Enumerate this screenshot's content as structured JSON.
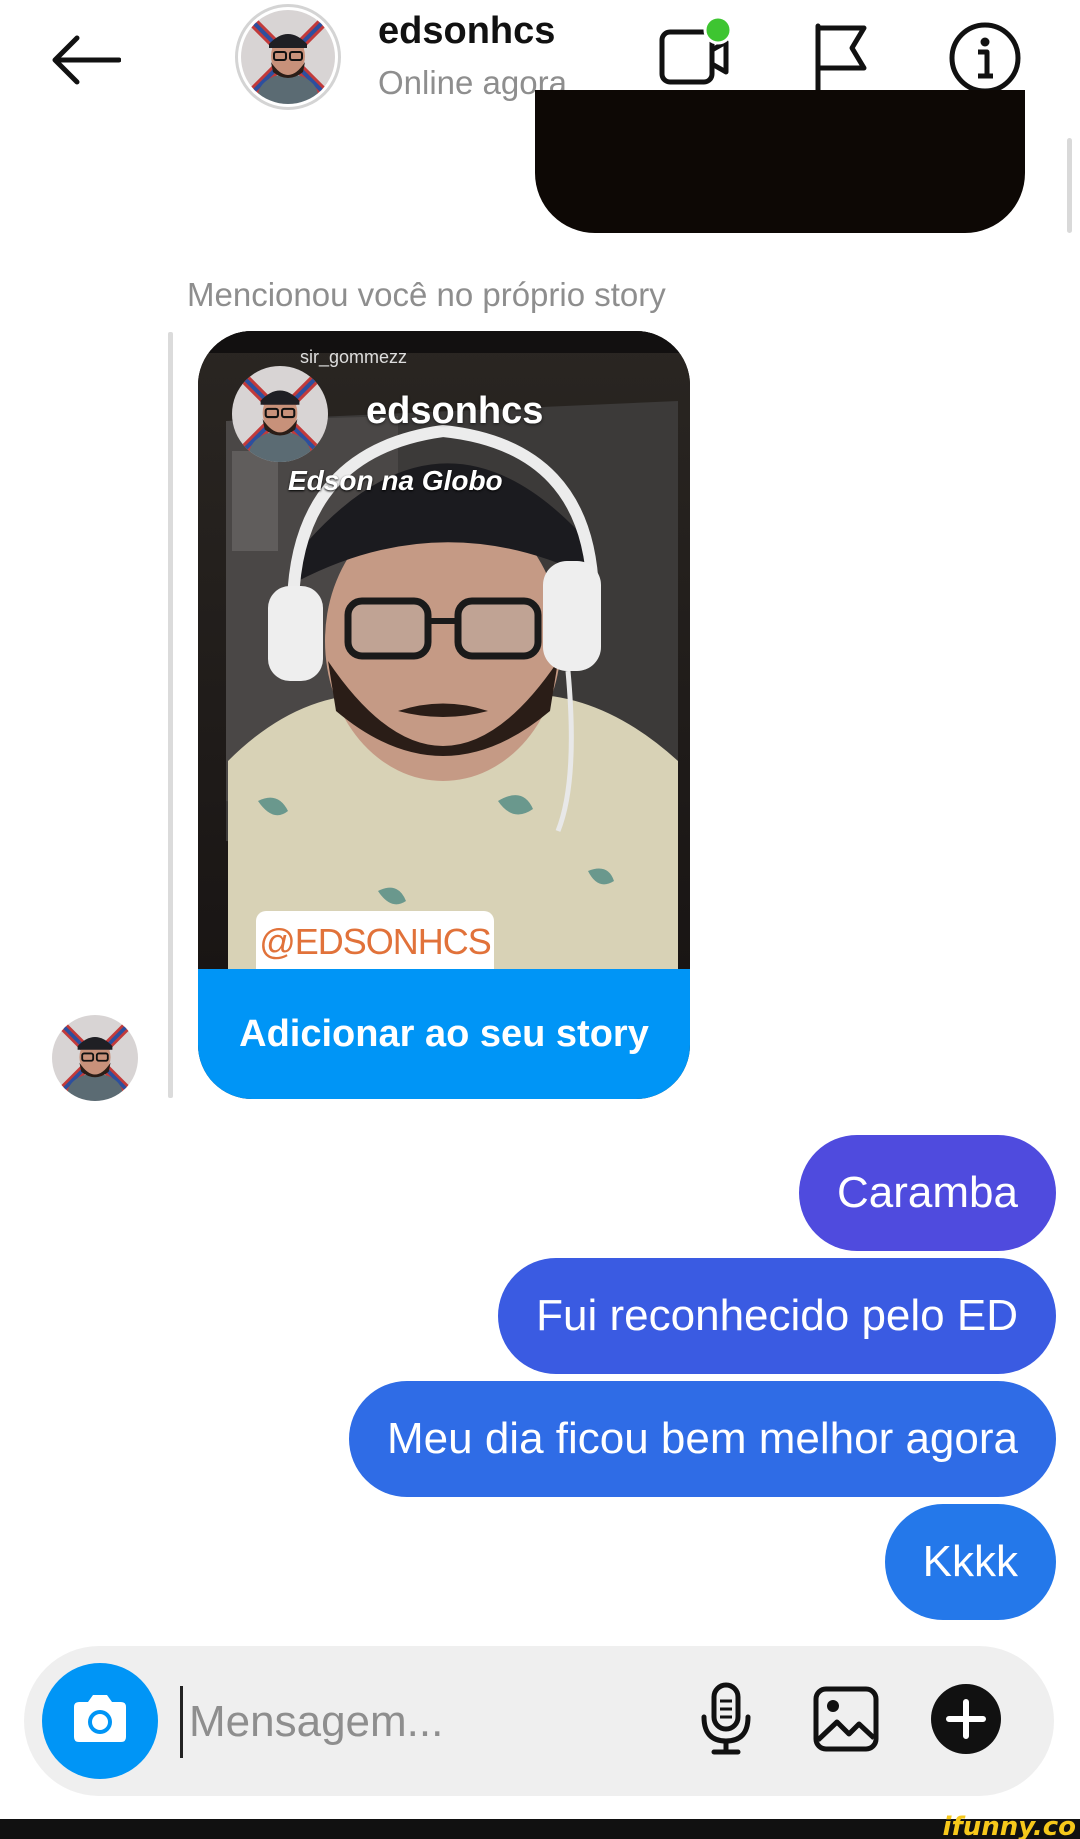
{
  "header": {
    "username": "edsonhcs",
    "status": "Online agora",
    "icons": [
      "back-arrow-icon",
      "video-call-icon",
      "flag-icon",
      "info-icon"
    ],
    "online_dot_color": "#3ec531"
  },
  "mention": {
    "caption": "Mencionou você no próprio story"
  },
  "story": {
    "sub_username": "sir_gommezz",
    "username": "edsonhcs",
    "caption": "Edson na Globo",
    "mention_tag": "@EDSONHCS",
    "add_button_label": "Adicionar ao seu story"
  },
  "messages": [
    {
      "text": "Caramba",
      "color": "#4f4bde"
    },
    {
      "text": "Fui reconhecido pelo ED",
      "color": "#3a5be2"
    },
    {
      "text": "Meu dia ficou bem melhor agora",
      "color": "#2f6ce6"
    },
    {
      "text": "Kkkk",
      "color": "#2478ea"
    }
  ],
  "composer": {
    "placeholder": "Mensagem...",
    "icons": [
      "camera-icon",
      "microphone-icon",
      "gallery-icon",
      "plus-icon"
    ]
  },
  "watermark": "ifunny.co"
}
